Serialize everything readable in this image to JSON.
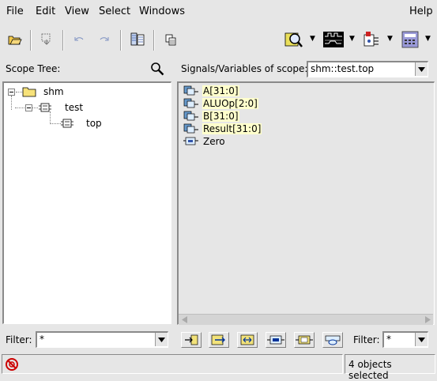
{
  "menubar": {
    "file": "File",
    "edit": "Edit",
    "view": "View",
    "select": "Select",
    "windows": "Windows",
    "help": "Help"
  },
  "toolbar": {
    "icons": [
      "open-folder-icon",
      "send-icon",
      "undo-icon",
      "redo-icon",
      "browser-icon",
      "copy-icon",
      "design-browser-icon",
      "waveform-icon",
      "schematic-icon",
      "register-icon"
    ]
  },
  "scope_tree": {
    "label": "Scope Tree:",
    "items": [
      {
        "label": "shm"
      },
      {
        "label": "test"
      },
      {
        "label": "top"
      }
    ]
  },
  "signals": {
    "label": "Signals/Variables of scope:",
    "scope_value": "shm::test.top",
    "items": [
      {
        "label": "A[31:0]"
      },
      {
        "label": "ALUOp[2:0]"
      },
      {
        "label": "B[31:0]"
      },
      {
        "label": "Result[31:0]"
      },
      {
        "label": "Zero"
      }
    ]
  },
  "filter_left": {
    "label": "Filter:",
    "value": "*"
  },
  "filter_right": {
    "label": "Filter:",
    "value": "*"
  },
  "status": {
    "text": "4 objects selected"
  },
  "colors": {
    "highlight": "#ffffcc",
    "background": "#e6e6e6"
  }
}
